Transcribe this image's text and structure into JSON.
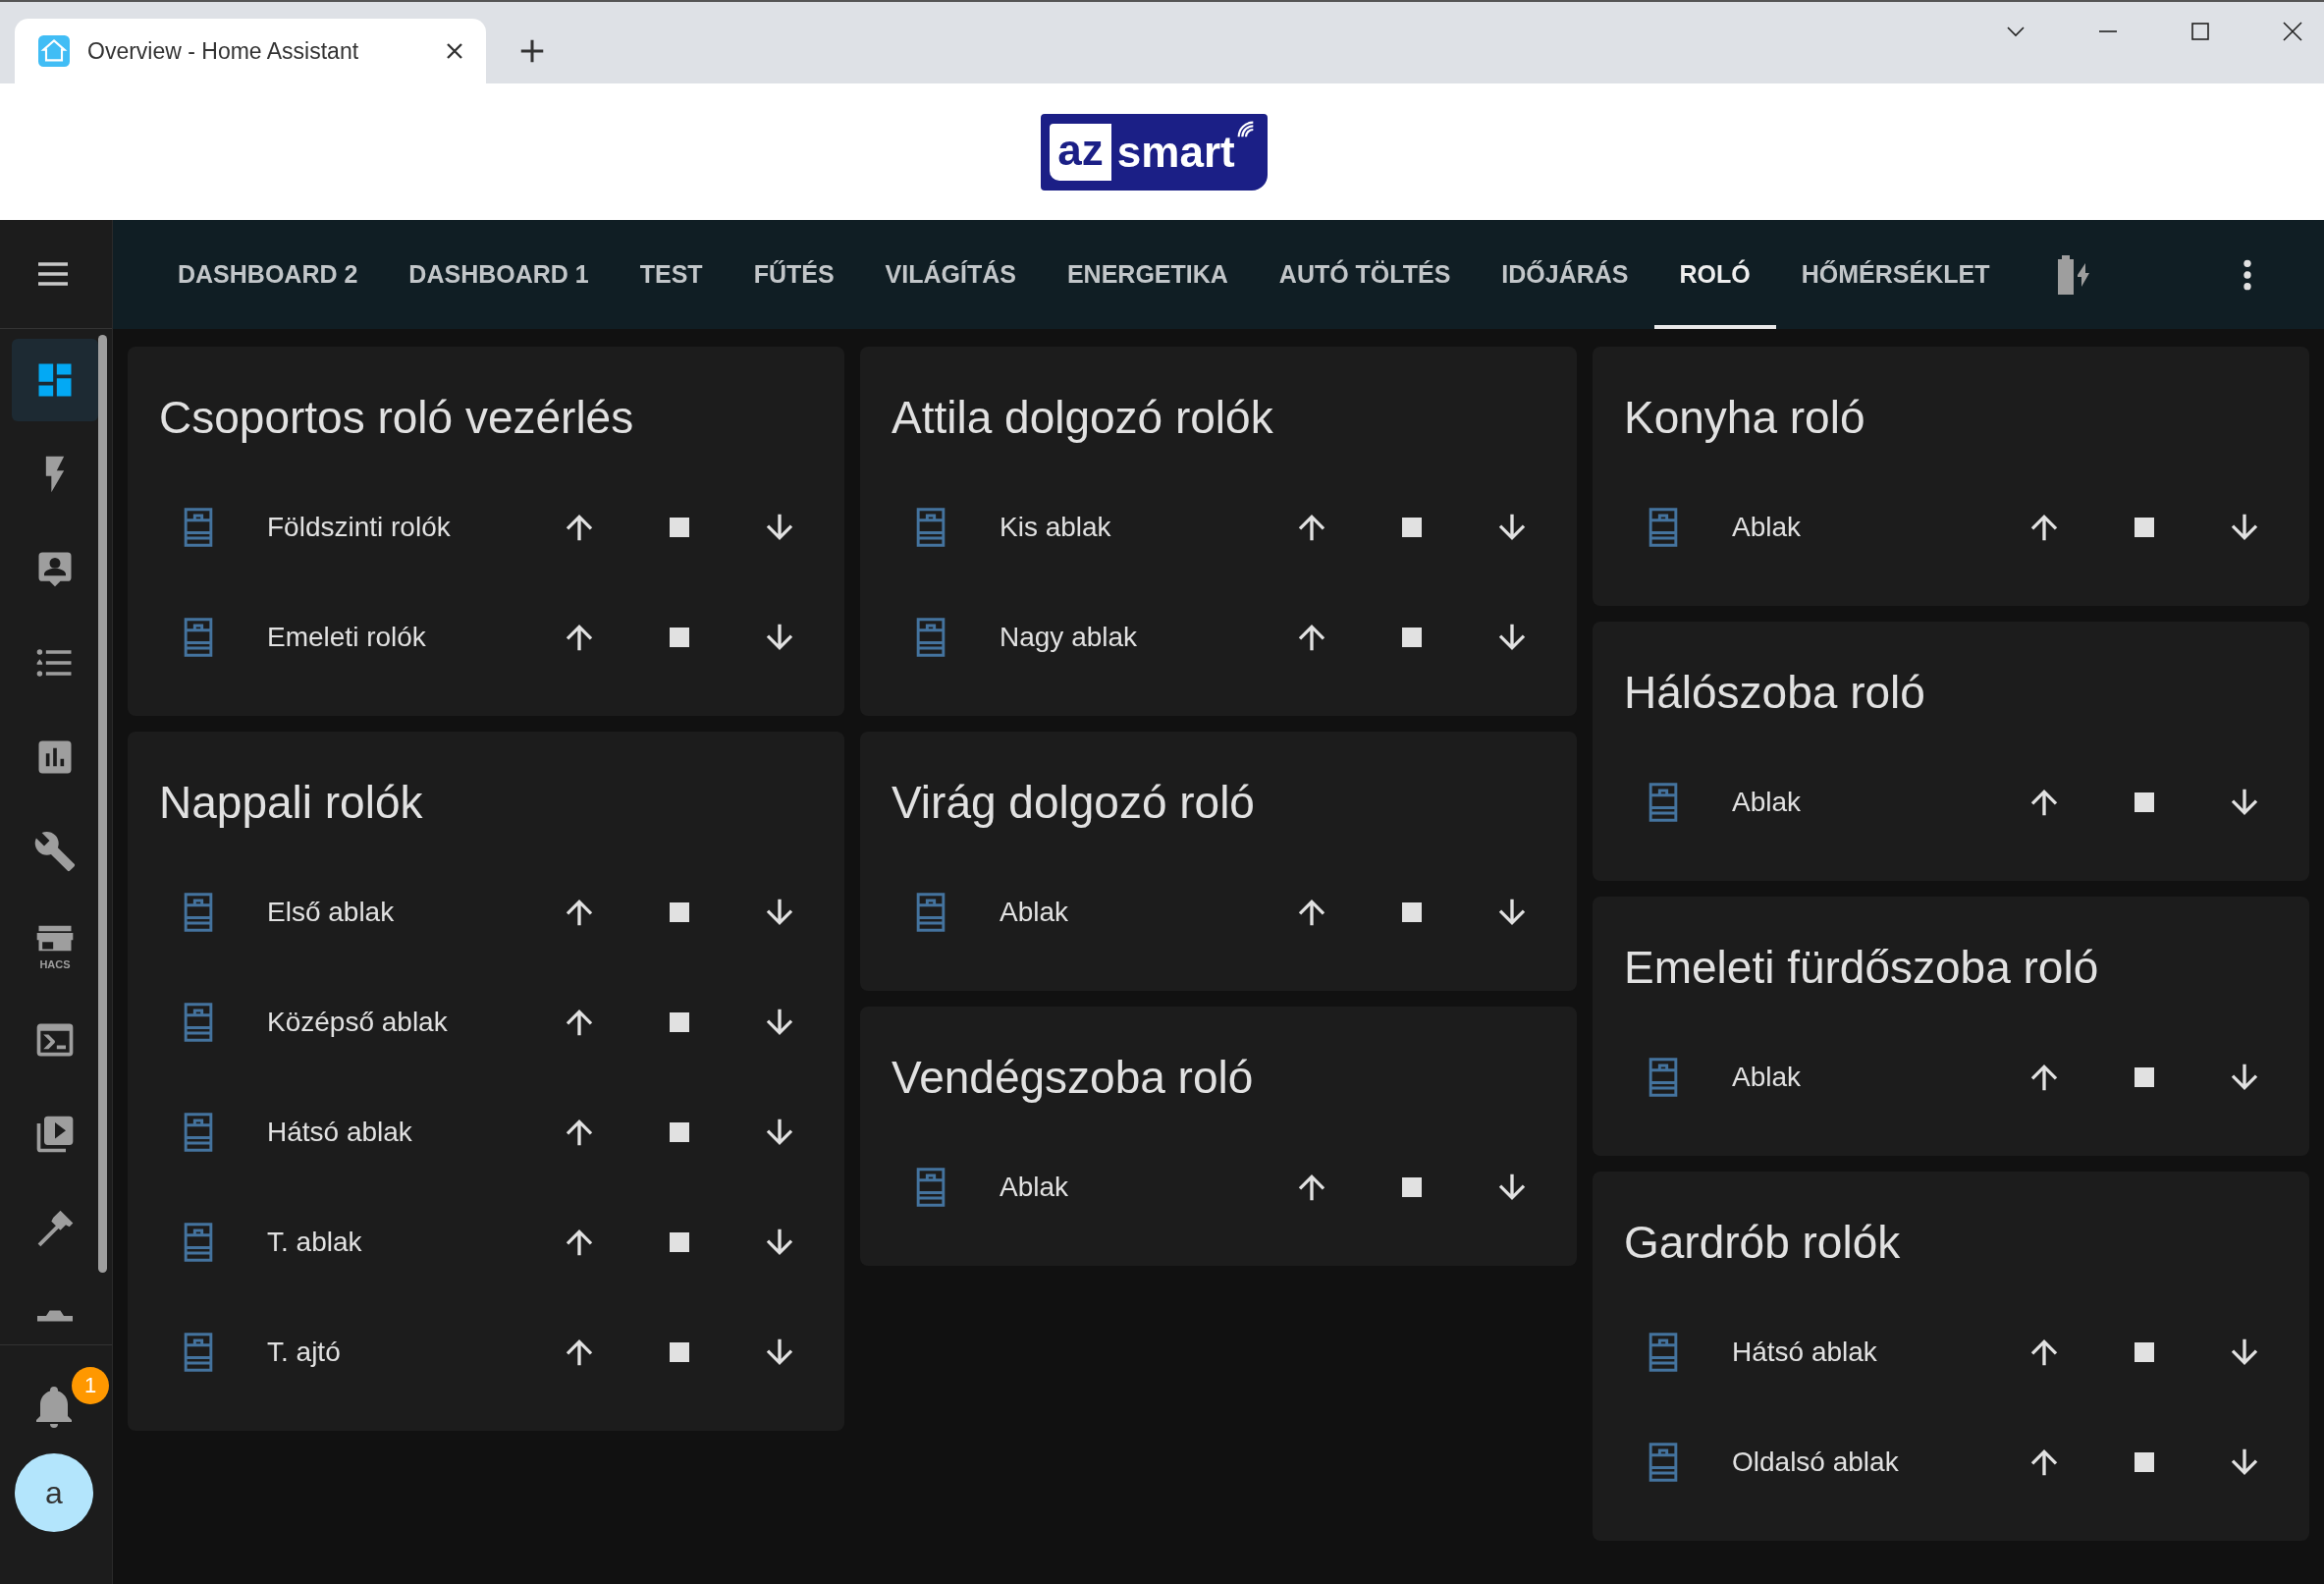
{
  "browser": {
    "tab_title": "Overview - Home Assistant"
  },
  "banner": {
    "logo": {
      "left": "az",
      "right": "smart"
    }
  },
  "toolbar": {
    "tabs": [
      {
        "label": "DASHBOARD 2",
        "selected": false
      },
      {
        "label": "DASHBOARD 1",
        "selected": false
      },
      {
        "label": "TEST",
        "selected": false
      },
      {
        "label": "FŰTÉS",
        "selected": false
      },
      {
        "label": "VILÁGÍTÁS",
        "selected": false
      },
      {
        "label": "ENERGETIKA",
        "selected": false
      },
      {
        "label": "AUTÓ TÖLTÉS",
        "selected": false
      },
      {
        "label": "IDŐJÁRÁS",
        "selected": false
      },
      {
        "label": "ROLÓ",
        "selected": true
      },
      {
        "label": "HŐMÉRSÉKLET",
        "selected": false
      }
    ]
  },
  "sidebar": {
    "items": [
      {
        "kind": "dashboard",
        "selected": true
      },
      {
        "kind": "energy",
        "selected": false
      },
      {
        "kind": "person",
        "selected": false
      },
      {
        "kind": "list",
        "selected": false
      },
      {
        "kind": "chart",
        "selected": false
      },
      {
        "kind": "wrench",
        "selected": false
      },
      {
        "kind": "store",
        "selected": false,
        "caption": "HACS"
      },
      {
        "kind": "terminal",
        "selected": false
      },
      {
        "kind": "media",
        "selected": false
      },
      {
        "kind": "hammer",
        "selected": false
      },
      {
        "kind": "partial",
        "selected": false
      }
    ],
    "notifications": {
      "badge": "1"
    },
    "user": {
      "initial": "a"
    }
  },
  "columns": [
    [
      {
        "title": "Csoportos roló vezérlés",
        "rows": [
          {
            "name": "Földszinti rolók"
          },
          {
            "name": "Emeleti rolók"
          }
        ]
      },
      {
        "title": "Nappali rolók",
        "rows": [
          {
            "name": "Első ablak"
          },
          {
            "name": "Középső ablak"
          },
          {
            "name": "Hátsó ablak"
          },
          {
            "name": "T. ablak"
          },
          {
            "name": "T. ajtó"
          }
        ]
      }
    ],
    [
      {
        "title": "Attila dolgozó rolók",
        "rows": [
          {
            "name": "Kis ablak"
          },
          {
            "name": "Nagy ablak"
          }
        ]
      },
      {
        "title": "Virág dolgozó roló",
        "rows": [
          {
            "name": "Ablak"
          }
        ]
      },
      {
        "title": "Vendégszoba roló",
        "rows": [
          {
            "name": "Ablak"
          }
        ]
      }
    ],
    [
      {
        "title": "Konyha roló",
        "rows": [
          {
            "name": "Ablak"
          }
        ]
      },
      {
        "title": "Hálószoba roló",
        "rows": [
          {
            "name": "Ablak"
          }
        ]
      },
      {
        "title": "Emeleti fürdőszoba roló",
        "rows": [
          {
            "name": "Ablak"
          }
        ]
      },
      {
        "title": "Gardrób rolók",
        "rows": [
          {
            "name": "Hátsó ablak"
          },
          {
            "name": "Oldalsó ablak"
          }
        ]
      }
    ]
  ]
}
